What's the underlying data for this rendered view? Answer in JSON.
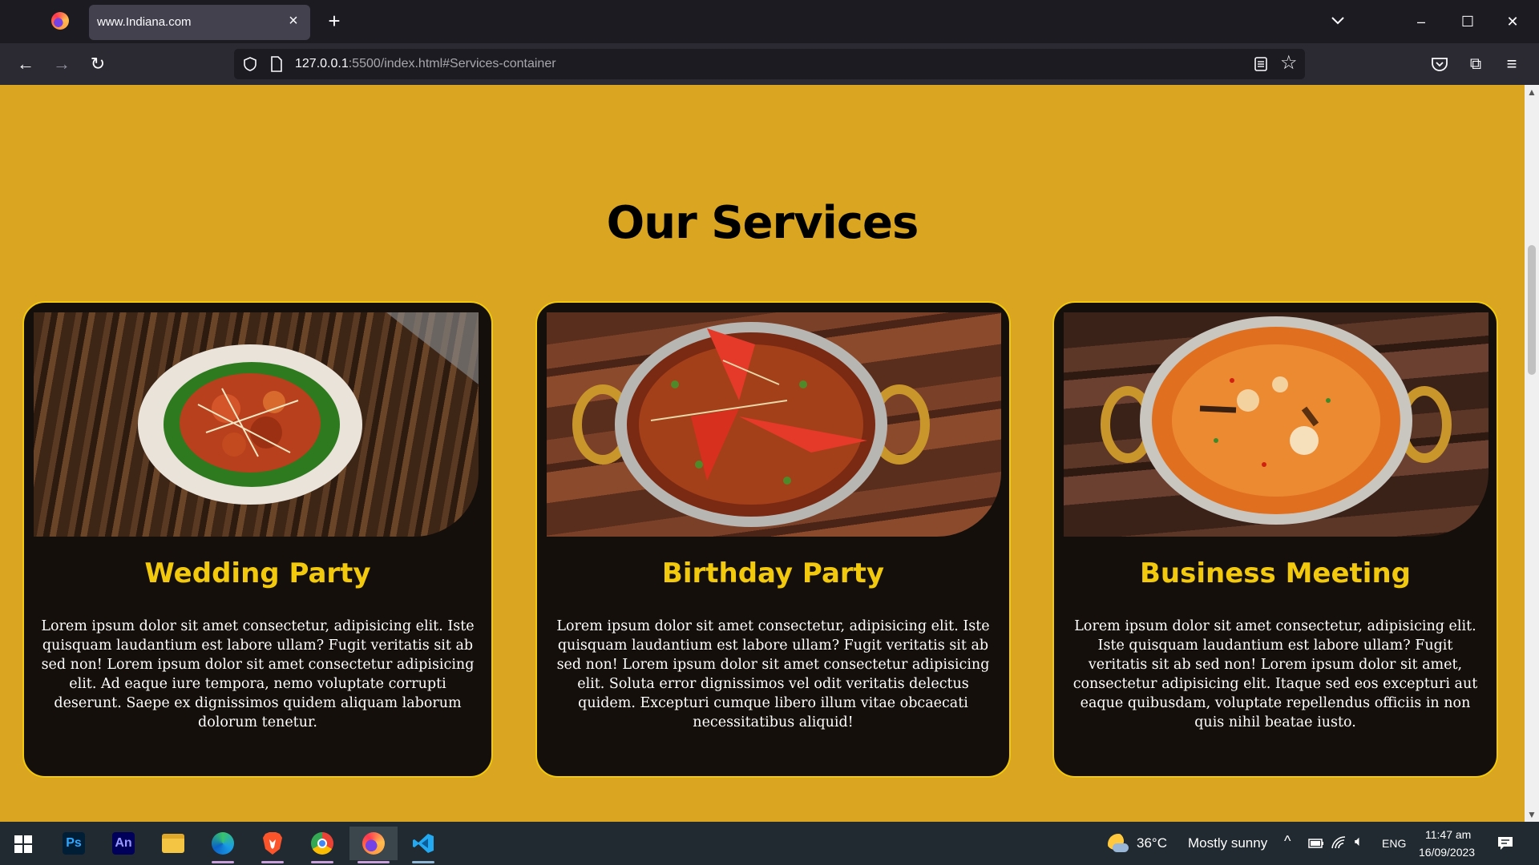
{
  "browser": {
    "tab_title": "www.Indiana.com",
    "url_host": "127.0.0.1",
    "url_rest": ":5500/index.html#Services-container"
  },
  "page": {
    "section_title": "Our Services",
    "cards": [
      {
        "title": "Wedding Party",
        "text": "Lorem ipsum dolor sit amet consectetur, adipisicing elit. Iste quisquam laudantium est labore ullam? Fugit veritatis sit ab sed non! Lorem ipsum dolor sit amet consectetur adipisicing elit. Ad eaque iure tempora, nemo voluptate corrupti deserunt. Saepe ex dignissimos quidem aliquam laborum dolorum tenetur."
      },
      {
        "title": "Birthday Party",
        "text": "Lorem ipsum dolor sit amet consectetur, adipisicing elit. Iste quisquam laudantium est labore ullam? Fugit veritatis sit ab sed non! Lorem ipsum dolor sit amet consectetur adipisicing elit. Soluta error dignissimos vel odit veritatis delectus quidem. Excepturi cumque libero illum vitae obcaecati necessitatibus aliquid!"
      },
      {
        "title": "Business Meeting",
        "text": "Lorem ipsum dolor sit amet consectetur, adipisicing elit. Iste quisquam laudantium est labore ullam? Fugit veritatis sit ab sed non! Lorem ipsum dolor sit amet, consectetur adipisicing elit. Itaque sed eos excepturi aut eaque quibusdam, voluptate repellendus officiis in non quis nihil beatae iusto."
      }
    ]
  },
  "taskbar": {
    "apps": [
      "windows-start",
      "photoshop",
      "animate",
      "file-explorer",
      "edge",
      "brave",
      "chrome",
      "firefox",
      "vscode"
    ],
    "ps_label": "Ps",
    "an_label": "An",
    "weather_temp": "36°C",
    "weather_desc": "Mostly sunny",
    "language": "ENG",
    "time": "11:47 am",
    "date": "16/09/2023"
  },
  "colors": {
    "page_bg": "#daa520",
    "card_bg": "#140f0a",
    "accent_yellow": "#f2c90c"
  }
}
